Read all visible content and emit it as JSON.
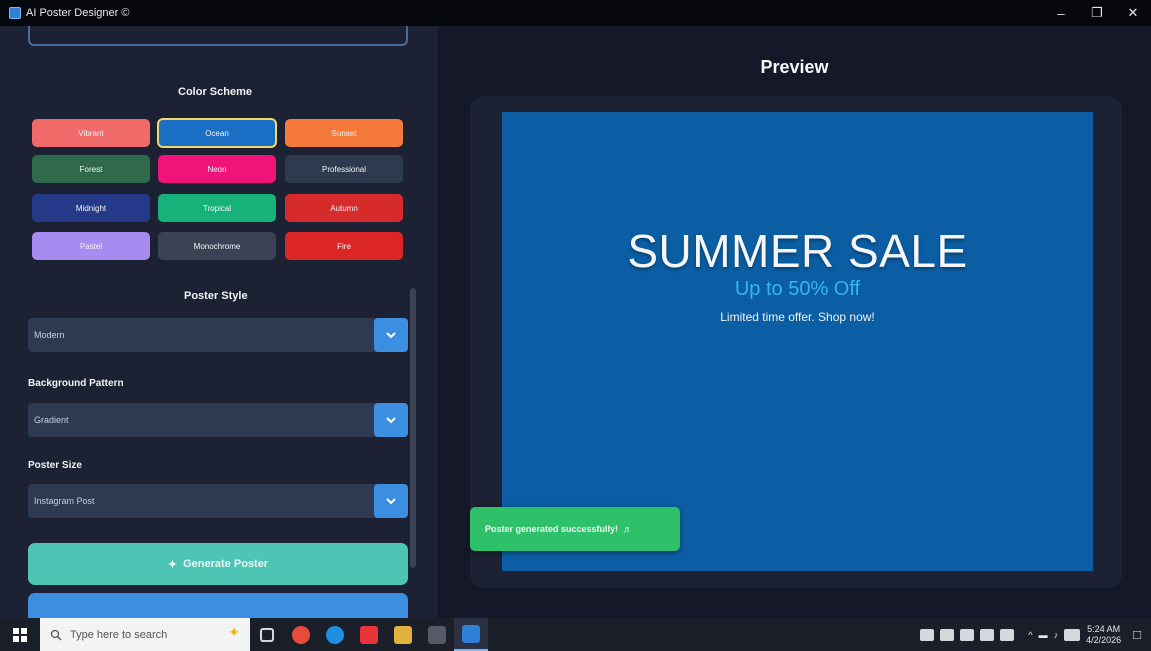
{
  "window": {
    "title": "AI Poster Designer ©"
  },
  "left_panel": {
    "color_scheme_title": "Color Scheme",
    "swatches": [
      {
        "label": "Vibrant",
        "color": "#f06a6a"
      },
      {
        "label": "Ocean",
        "color": "#1a6fc4",
        "selected": true
      },
      {
        "label": "Sunset",
        "color": "#f5793a"
      },
      {
        "label": "Forest",
        "color": "#2f6b4a"
      },
      {
        "label": "Neon",
        "color": "#f0147a"
      },
      {
        "label": "Professional",
        "color": "#2e3a4e"
      },
      {
        "label": "Midnight",
        "color": "#263a8a"
      },
      {
        "label": "Tropical",
        "color": "#17b27a"
      },
      {
        "label": "Autumn",
        "color": "#d62b2b"
      },
      {
        "label": "Pastel",
        "color": "#a78bf0"
      },
      {
        "label": "Monochrome",
        "color": "#3b4254"
      },
      {
        "label": "Fire",
        "color": "#dc2626"
      }
    ],
    "poster_style_title": "Poster Style",
    "poster_style_value": "Modern",
    "background_pattern_label": "Background Pattern",
    "background_pattern_value": "Gradient",
    "poster_size_label": "Poster Size",
    "poster_size_value": "Instagram Post",
    "generate_label": "Generate Poster",
    "generate_icon": "sparkle-icon"
  },
  "preview": {
    "title": "Preview",
    "poster": {
      "headline": "SUMMER SALE",
      "subheadline": "Up to 50% Off",
      "body": "Limited time offer. Shop now!",
      "background": "#0b5ea3"
    },
    "toast": {
      "message": "Poster generated successfully!",
      "icon": "party-icon"
    }
  },
  "taskbar": {
    "search_placeholder": "Type here to search",
    "clock_time": "5:24 AM",
    "clock_date": "4/2/2026"
  }
}
